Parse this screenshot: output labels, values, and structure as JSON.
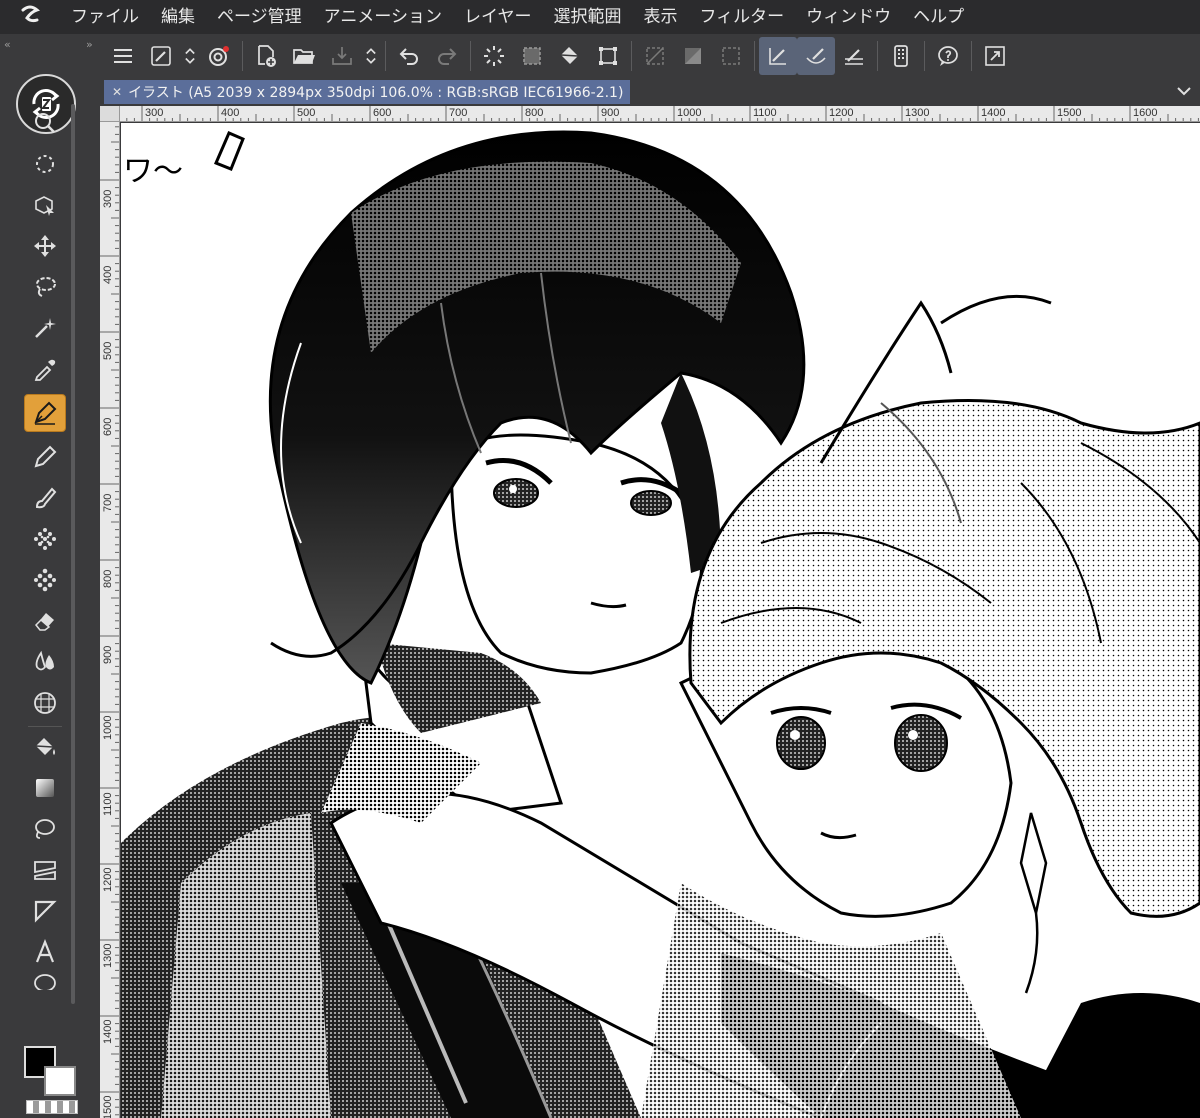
{
  "menu": {
    "items": [
      "ファイル",
      "編集",
      "ページ管理",
      "アニメーション",
      "レイヤー",
      "選択範囲",
      "表示",
      "フィルター",
      "ウィンドウ",
      "ヘルプ"
    ]
  },
  "tools": [
    {
      "icon": "zoom-icon"
    },
    {
      "icon": "rotate-view-icon"
    },
    {
      "icon": "object-select-icon"
    },
    {
      "icon": "move-icon"
    },
    {
      "icon": "lasso-select-icon"
    },
    {
      "icon": "magic-wand-icon"
    },
    {
      "icon": "eyedropper-icon"
    },
    {
      "icon": "pen-icon",
      "active": true
    },
    {
      "icon": "pencil-icon"
    },
    {
      "icon": "brush-icon"
    },
    {
      "icon": "airbrush-icon"
    },
    {
      "icon": "decoration-icon"
    },
    {
      "icon": "eraser-icon"
    },
    {
      "icon": "blend-icon"
    },
    {
      "icon": "ruler-grid-icon"
    },
    {
      "icon": "fill-icon"
    },
    {
      "icon": "gradient-icon"
    },
    {
      "icon": "shape-icon"
    },
    {
      "icon": "frame-border-icon"
    },
    {
      "icon": "ruler-icon"
    },
    {
      "icon": "text-icon"
    }
  ],
  "document": {
    "tab_label": "イラスト (A5 2039 x 2894px 350dpi 106.0% : RGB:sRGB IEC61966-2.1)"
  },
  "ruler": {
    "h_labels": [
      "300",
      "400",
      "500",
      "600",
      "700",
      "800",
      "900",
      "1000",
      "1100",
      "1200",
      "1300",
      "1400",
      "1500",
      "1600"
    ],
    "v_labels": [
      "300",
      "400",
      "500",
      "600",
      "700",
      "800",
      "900",
      "1000",
      "1100",
      "1200",
      "1300",
      "1400",
      "1500"
    ]
  },
  "canvas": {
    "sketch_text": "ワ〜"
  },
  "colors": {
    "accent_active_tool": "#e2a03a",
    "tab_background": "#5b6e9a",
    "active_command": "#5a6478",
    "main_color": "#000000",
    "sub_color": "#ffffff"
  }
}
